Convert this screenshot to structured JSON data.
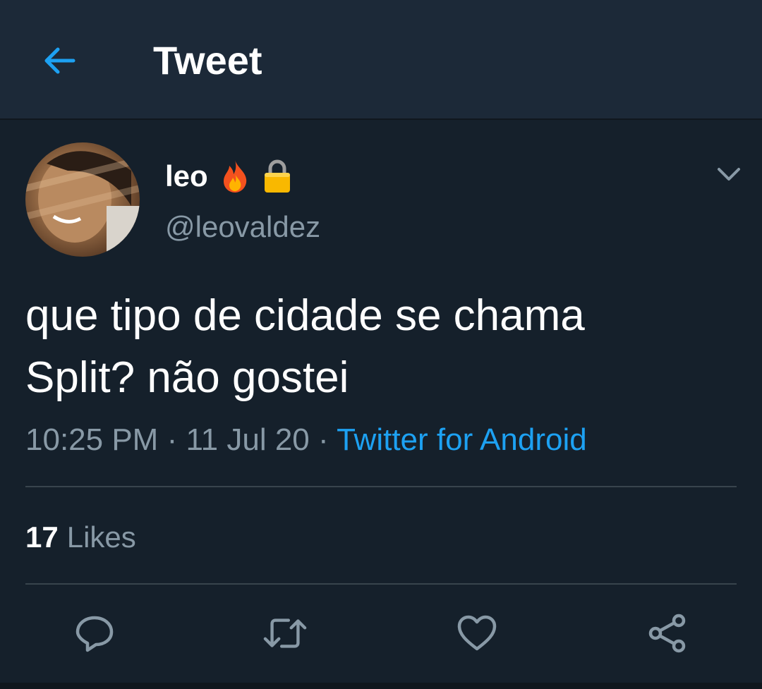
{
  "header": {
    "title": "Tweet",
    "back_icon": "arrow-left-icon"
  },
  "colors": {
    "background": "#15202b",
    "header": "#1c2938",
    "accent": "#1da1f2",
    "secondary_text": "#8899a6",
    "divider": "#38444d"
  },
  "tweet": {
    "author": {
      "display_name": "leo",
      "emojis": [
        "fire-emoji",
        "lock-emoji"
      ],
      "handle": "@leovaldez"
    },
    "text": "que tipo de cidade se chama\nSplit? não gostei",
    "time": "10:25 PM",
    "date": "11 Jul 20",
    "separator": "·",
    "source": "Twitter for Android",
    "likes_count": "17",
    "likes_label": "Likes"
  },
  "actions": [
    {
      "name": "reply",
      "icon": "reply-icon"
    },
    {
      "name": "retweet",
      "icon": "retweet-icon"
    },
    {
      "name": "like",
      "icon": "heart-icon"
    },
    {
      "name": "share",
      "icon": "share-icon"
    }
  ]
}
